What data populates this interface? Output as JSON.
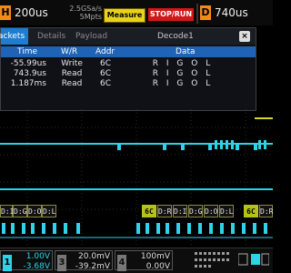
{
  "topbar": {
    "h_label": "H",
    "timebase": "200us",
    "sample_rate": "2.5GSa/s",
    "memory_depth": "5Mpts",
    "measure_label": "Measure",
    "stoprun_label": "STOP/RUN",
    "d_label": "D",
    "delay": "740us"
  },
  "decode_window": {
    "tabs": [
      "Packets",
      "Details",
      "Payload"
    ],
    "decoder_name": "Decode1",
    "close_label": "×",
    "columns": [
      "Time",
      "W/R",
      "Addr",
      "Data"
    ],
    "rows": [
      {
        "time": "-55.99us",
        "wr": "Write",
        "addr": "6C",
        "data": "R I G O L"
      },
      {
        "time": "743.9us",
        "wr": "Read",
        "addr": "6C",
        "data": "R I G O L"
      },
      {
        "time": "1.187ms",
        "wr": "Read",
        "addr": "6C",
        "data": "R I G O L"
      }
    ]
  },
  "bus": {
    "segments_left": [
      "D:I",
      "D:G",
      "D:O",
      "D:L"
    ],
    "segments_right": [
      "6C",
      "D:R",
      "D:I",
      "D:G",
      "D:O",
      "D:L",
      "6C",
      "D:R"
    ]
  },
  "bottombar": {
    "ch1": {
      "num": "1",
      "scale": "1.00V",
      "offset": "-3.68V"
    },
    "ch3": {
      "num": "3",
      "scale": "20.0mV",
      "offset": "-39.2mV"
    },
    "ch4": {
      "num": "4",
      "scale": "100mV",
      "offset": "0.00V"
    }
  },
  "colors": {
    "trace": "#2bd4e8",
    "accent_orange": "#f28a1a",
    "measure_yellow": "#e8d21a",
    "stop_red": "#d31616",
    "header_blue": "#1f63b7"
  }
}
